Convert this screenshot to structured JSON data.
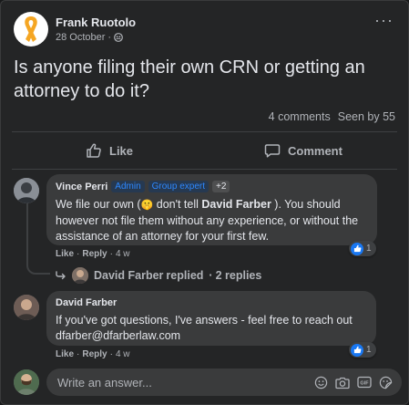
{
  "post": {
    "author": "Frank Ruotolo",
    "date": "28 October",
    "separator": "·",
    "text": "Is anyone filing their own CRN or getting an attorney to do it?",
    "comments_count": "4 comments",
    "seen_by": "Seen by 55",
    "more_label": "···"
  },
  "actions": {
    "like": "Like",
    "comment": "Comment"
  },
  "comments": [
    {
      "author": "Vince Perri",
      "badges": [
        "Admin",
        "Group expert",
        "+2"
      ],
      "text_before": "We file our own (",
      "emoji": "🤫",
      "text_mid": " don't tell ",
      "mention": "David Farber",
      "text_after": " ). You should however not file them without any experience, or without the assistance of an attorney for your first few.",
      "like": "Like",
      "reply": "Reply",
      "time": "4 w",
      "reaction_count": "1"
    },
    {
      "author": "David Farber",
      "text": "If you've got questions, I've answers - feel free to reach out dfarber@dfarberlaw.com",
      "like": "Like",
      "reply": "Reply",
      "time": "4 w",
      "reaction_count": "1"
    }
  ],
  "replied": {
    "name": "David Farber",
    "text": "replied",
    "count": "2 replies"
  },
  "composer": {
    "placeholder": "Write an answer..."
  }
}
